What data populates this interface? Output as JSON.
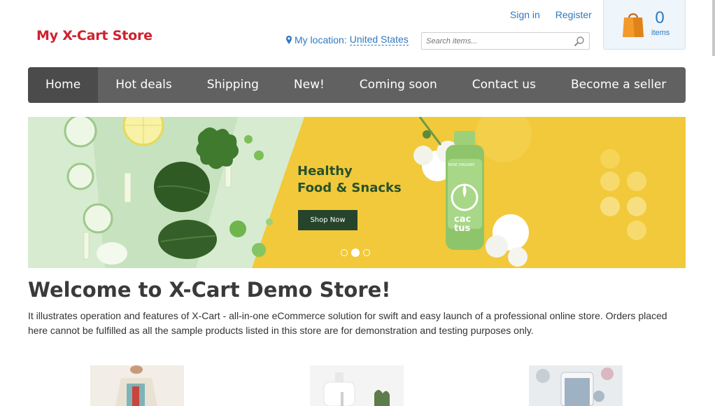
{
  "header": {
    "logo_text": "My X-Cart Store",
    "sign_in": "Sign in",
    "register": "Register",
    "location_label": "My location:",
    "location_value": "United States",
    "search_placeholder": "Search items...",
    "cart_count": "0",
    "cart_items_label": "items"
  },
  "nav": {
    "items": [
      "Home",
      "Hot deals",
      "Shipping",
      "New!",
      "Coming soon",
      "Contact us",
      "Become a seller"
    ],
    "active": "Home"
  },
  "banner": {
    "headline_line1": "Healthy",
    "headline_line2": "Food & Snacks",
    "button_label": "Shop Now",
    "bottle_brand": "BASE ORGANIC",
    "bottle_text_1": "cac",
    "bottle_text_2": "tus",
    "slide_count": 3,
    "active_slide": 2
  },
  "main": {
    "title": "Welcome to X-Cart Demo Store!",
    "intro": "It illustrates operation and features of X-Cart - all-in-one eCommerce solution for swift and easy launch of a professional online store. Orders placed here cannot be fulfilled as all the sample products listed in this store are for demonstration and testing purposes only."
  },
  "colors": {
    "brand_red": "#d0202e",
    "link_blue": "#2f79c1",
    "nav_bg": "#616161",
    "nav_active": "#4b4b4b",
    "banner_yellow": "#f1c93a",
    "button_green": "#26442b"
  },
  "icons": [
    "map-pin-icon",
    "search-icon",
    "shopping-bag-icon"
  ]
}
